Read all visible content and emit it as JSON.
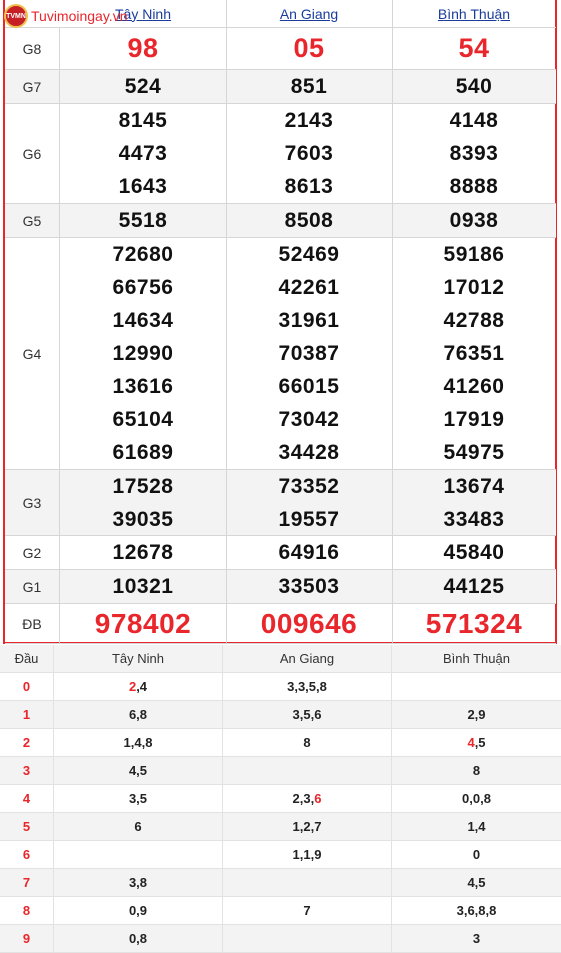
{
  "brand": {
    "name": "Tuvimoingay.vn",
    "logo_text": "TVMN"
  },
  "provinces": [
    "Tây Ninh",
    "An Giang",
    "Bình Thuận"
  ],
  "prizes": [
    {
      "label": "G8",
      "values": [
        [
          "98"
        ],
        [
          "05"
        ],
        [
          "54"
        ]
      ]
    },
    {
      "label": "G7",
      "values": [
        [
          "524"
        ],
        [
          "851"
        ],
        [
          "540"
        ]
      ]
    },
    {
      "label": "G6",
      "values": [
        [
          "8145",
          "4473",
          "1643"
        ],
        [
          "2143",
          "7603",
          "8613"
        ],
        [
          "4148",
          "8393",
          "8888"
        ]
      ]
    },
    {
      "label": "G5",
      "values": [
        [
          "5518"
        ],
        [
          "8508"
        ],
        [
          "0938"
        ]
      ]
    },
    {
      "label": "G4",
      "values": [
        [
          "72680",
          "66756",
          "14634",
          "12990",
          "13616",
          "65104",
          "61689"
        ],
        [
          "52469",
          "42261",
          "31961",
          "70387",
          "66015",
          "73042",
          "34428"
        ],
        [
          "59186",
          "17012",
          "42788",
          "76351",
          "41260",
          "17919",
          "54975"
        ]
      ]
    },
    {
      "label": "G3",
      "values": [
        [
          "17528",
          "39035"
        ],
        [
          "73352",
          "19557"
        ],
        [
          "13674",
          "33483"
        ]
      ]
    },
    {
      "label": "G2",
      "values": [
        [
          "12678"
        ],
        [
          "64916"
        ],
        [
          "45840"
        ]
      ]
    },
    {
      "label": "G1",
      "values": [
        [
          "10321"
        ],
        [
          "33503"
        ],
        [
          "44125"
        ]
      ]
    },
    {
      "label": "ĐB",
      "values": [
        [
          "978402"
        ],
        [
          "009646"
        ],
        [
          "571324"
        ]
      ]
    }
  ],
  "head_table": {
    "header": [
      "Đầu",
      "Tây Ninh",
      "An Giang",
      "Bình Thuận"
    ],
    "rows": [
      {
        "dau": "0",
        "cols": [
          [
            {
              "t": "2",
              "hl": true
            },
            {
              "t": ",4"
            }
          ],
          [
            {
              "t": "3,3,5,8"
            }
          ],
          []
        ]
      },
      {
        "dau": "1",
        "cols": [
          [
            {
              "t": "6,8"
            }
          ],
          [
            {
              "t": "3,5,6"
            }
          ],
          [
            {
              "t": "2,9"
            }
          ]
        ]
      },
      {
        "dau": "2",
        "cols": [
          [
            {
              "t": "1,4,8"
            }
          ],
          [
            {
              "t": "8"
            }
          ],
          [
            {
              "t": "4",
              "hl": true
            },
            {
              "t": ",5"
            }
          ]
        ]
      },
      {
        "dau": "3",
        "cols": [
          [
            {
              "t": "4,5"
            }
          ],
          [],
          [
            {
              "t": "8"
            }
          ]
        ]
      },
      {
        "dau": "4",
        "cols": [
          [
            {
              "t": "3,5"
            }
          ],
          [
            {
              "t": "2,3,"
            },
            {
              "t": "6",
              "hl": true
            }
          ],
          [
            {
              "t": "0,0,8"
            }
          ]
        ]
      },
      {
        "dau": "5",
        "cols": [
          [
            {
              "t": "6"
            }
          ],
          [
            {
              "t": "1,2,7"
            }
          ],
          [
            {
              "t": "1,4"
            }
          ]
        ]
      },
      {
        "dau": "6",
        "cols": [
          [],
          [
            {
              "t": "1,1,9"
            }
          ],
          [
            {
              "t": "0"
            }
          ]
        ]
      },
      {
        "dau": "7",
        "cols": [
          [
            {
              "t": "3,8"
            }
          ],
          [],
          [
            {
              "t": "4,5"
            }
          ]
        ]
      },
      {
        "dau": "8",
        "cols": [
          [
            {
              "t": "0,9"
            }
          ],
          [
            {
              "t": "7"
            }
          ],
          [
            {
              "t": "3,6,8,8"
            }
          ]
        ]
      },
      {
        "dau": "9",
        "cols": [
          [
            {
              "t": "0,8"
            }
          ],
          [],
          [
            {
              "t": "3"
            }
          ]
        ]
      }
    ]
  },
  "colors": {
    "accent": "#e8262b",
    "link": "#1a3c9c",
    "alt_row": "#f3f3f3"
  }
}
